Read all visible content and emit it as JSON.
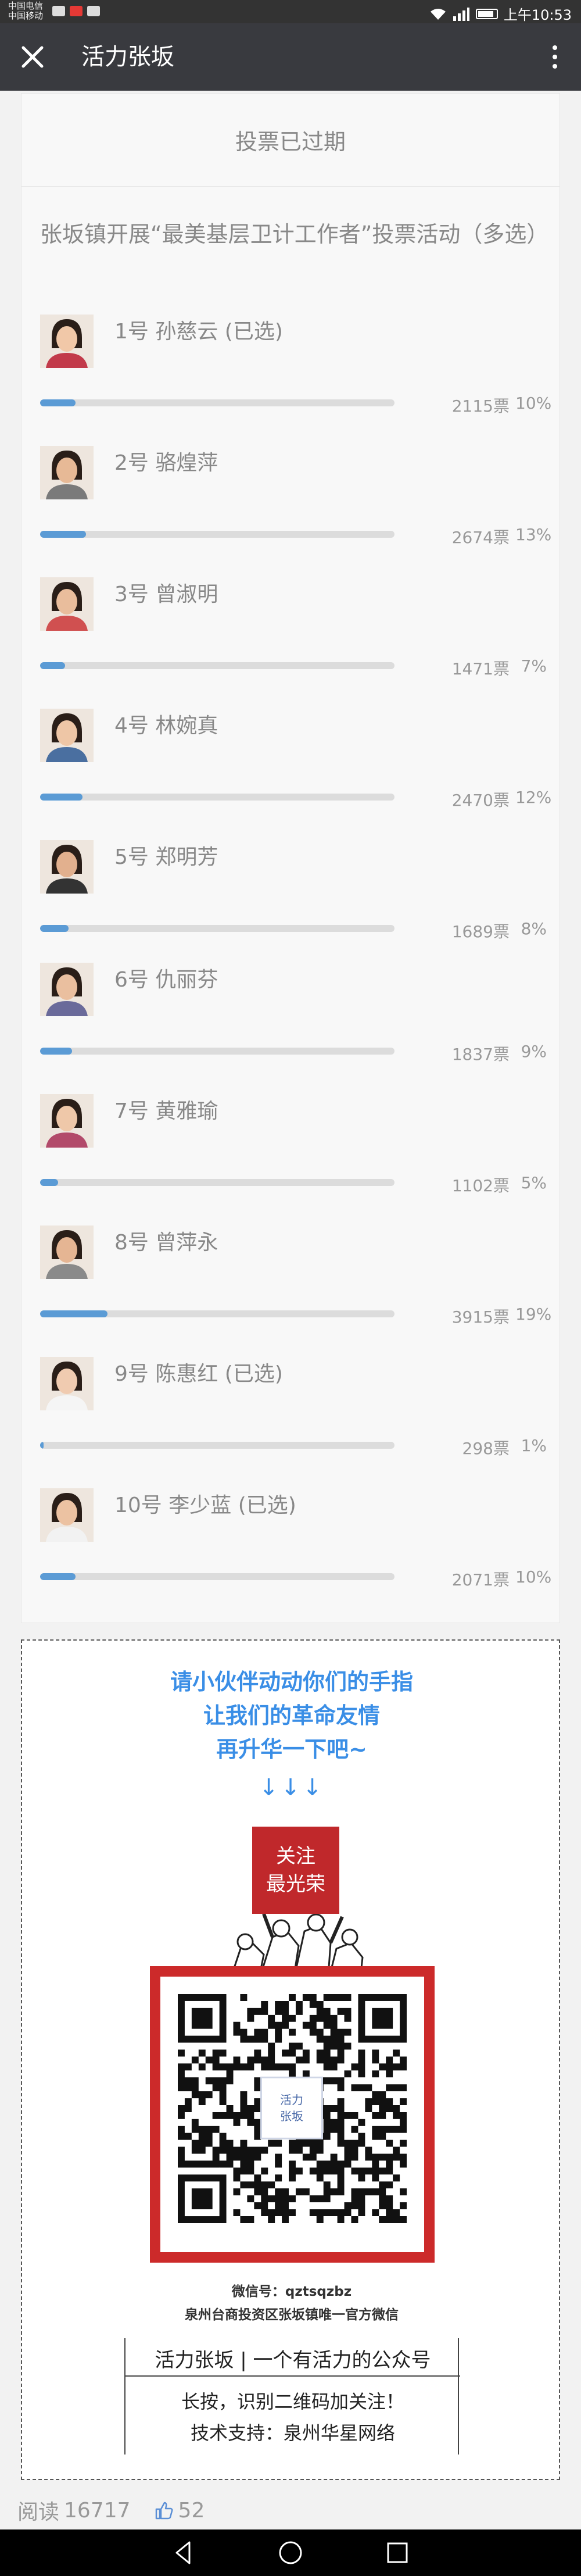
{
  "status_bar": {
    "carrier_line1": "中国电信",
    "carrier_line2": "中国移动",
    "time": "上午10:53"
  },
  "title_bar": {
    "title": "活力张坂"
  },
  "vote": {
    "status": "投票已过期",
    "title": "张坂镇开展“最美基层卫计工作者”投票活动（多选）",
    "candidates": [
      {
        "name": "1号 孙慈云 (已选)",
        "votes": "2115票",
        "percent": "10%",
        "fraction": 0.1
      },
      {
        "name": "2号 骆煌萍",
        "votes": "2674票",
        "percent": "13%",
        "fraction": 0.13
      },
      {
        "name": "3号 曾淑明",
        "votes": "1471票",
        "percent": "7%",
        "fraction": 0.07
      },
      {
        "name": "4号 林婉真",
        "votes": "2470票",
        "percent": "12%",
        "fraction": 0.12
      },
      {
        "name": "5号 郑明芳",
        "votes": "1689票",
        "percent": "8%",
        "fraction": 0.08
      },
      {
        "name": "6号 仇丽芬",
        "votes": "1837票",
        "percent": "9%",
        "fraction": 0.09
      },
      {
        "name": "7号 黄雅瑜",
        "votes": "1102票",
        "percent": "5%",
        "fraction": 0.05
      },
      {
        "name": "8号 曾萍永",
        "votes": "3915票",
        "percent": "19%",
        "fraction": 0.19
      },
      {
        "name": "9号 陈惠红 (已选)",
        "votes": "298票",
        "percent": "1%",
        "fraction": 0.01
      },
      {
        "name": "10号 李少蓝 (已选)",
        "votes": "2071票",
        "percent": "10%",
        "fraction": 0.1
      }
    ]
  },
  "promo": {
    "line1": "请小伙伴动动你们的手指",
    "line2": "让我们的革命友情",
    "line3": "再升华一下吧~",
    "arrows": "↓↓↓",
    "badge_line1": "关注",
    "badge_line2": "最光荣",
    "qr_logo_line1": "活力",
    "qr_logo_line2": "张坂",
    "wechat_id": "微信号：qztsqzbz",
    "wechat_desc": "泉州台商投资区张坂镇唯一官方微信",
    "footer_title": "活力张坂 | 一个有活力的公众号",
    "footer_line1": "长按，识别二维码加关注！",
    "footer_line2": "技术支持：泉州华星网络"
  },
  "stats": {
    "read_label": "阅读",
    "read_count": "16717",
    "like_count": "52"
  },
  "colors": {
    "titlebar": "#393a3f",
    "progress": "#5b9bd5",
    "promo_text": "#3a8ee6",
    "badge": "#c0282b",
    "qr_frame": "#cc2a2a"
  },
  "icons": [
    "close-icon",
    "more-icon",
    "wifi-icon",
    "signal-icon",
    "battery-icon",
    "like-icon",
    "back-icon",
    "home-icon",
    "recents-icon"
  ]
}
